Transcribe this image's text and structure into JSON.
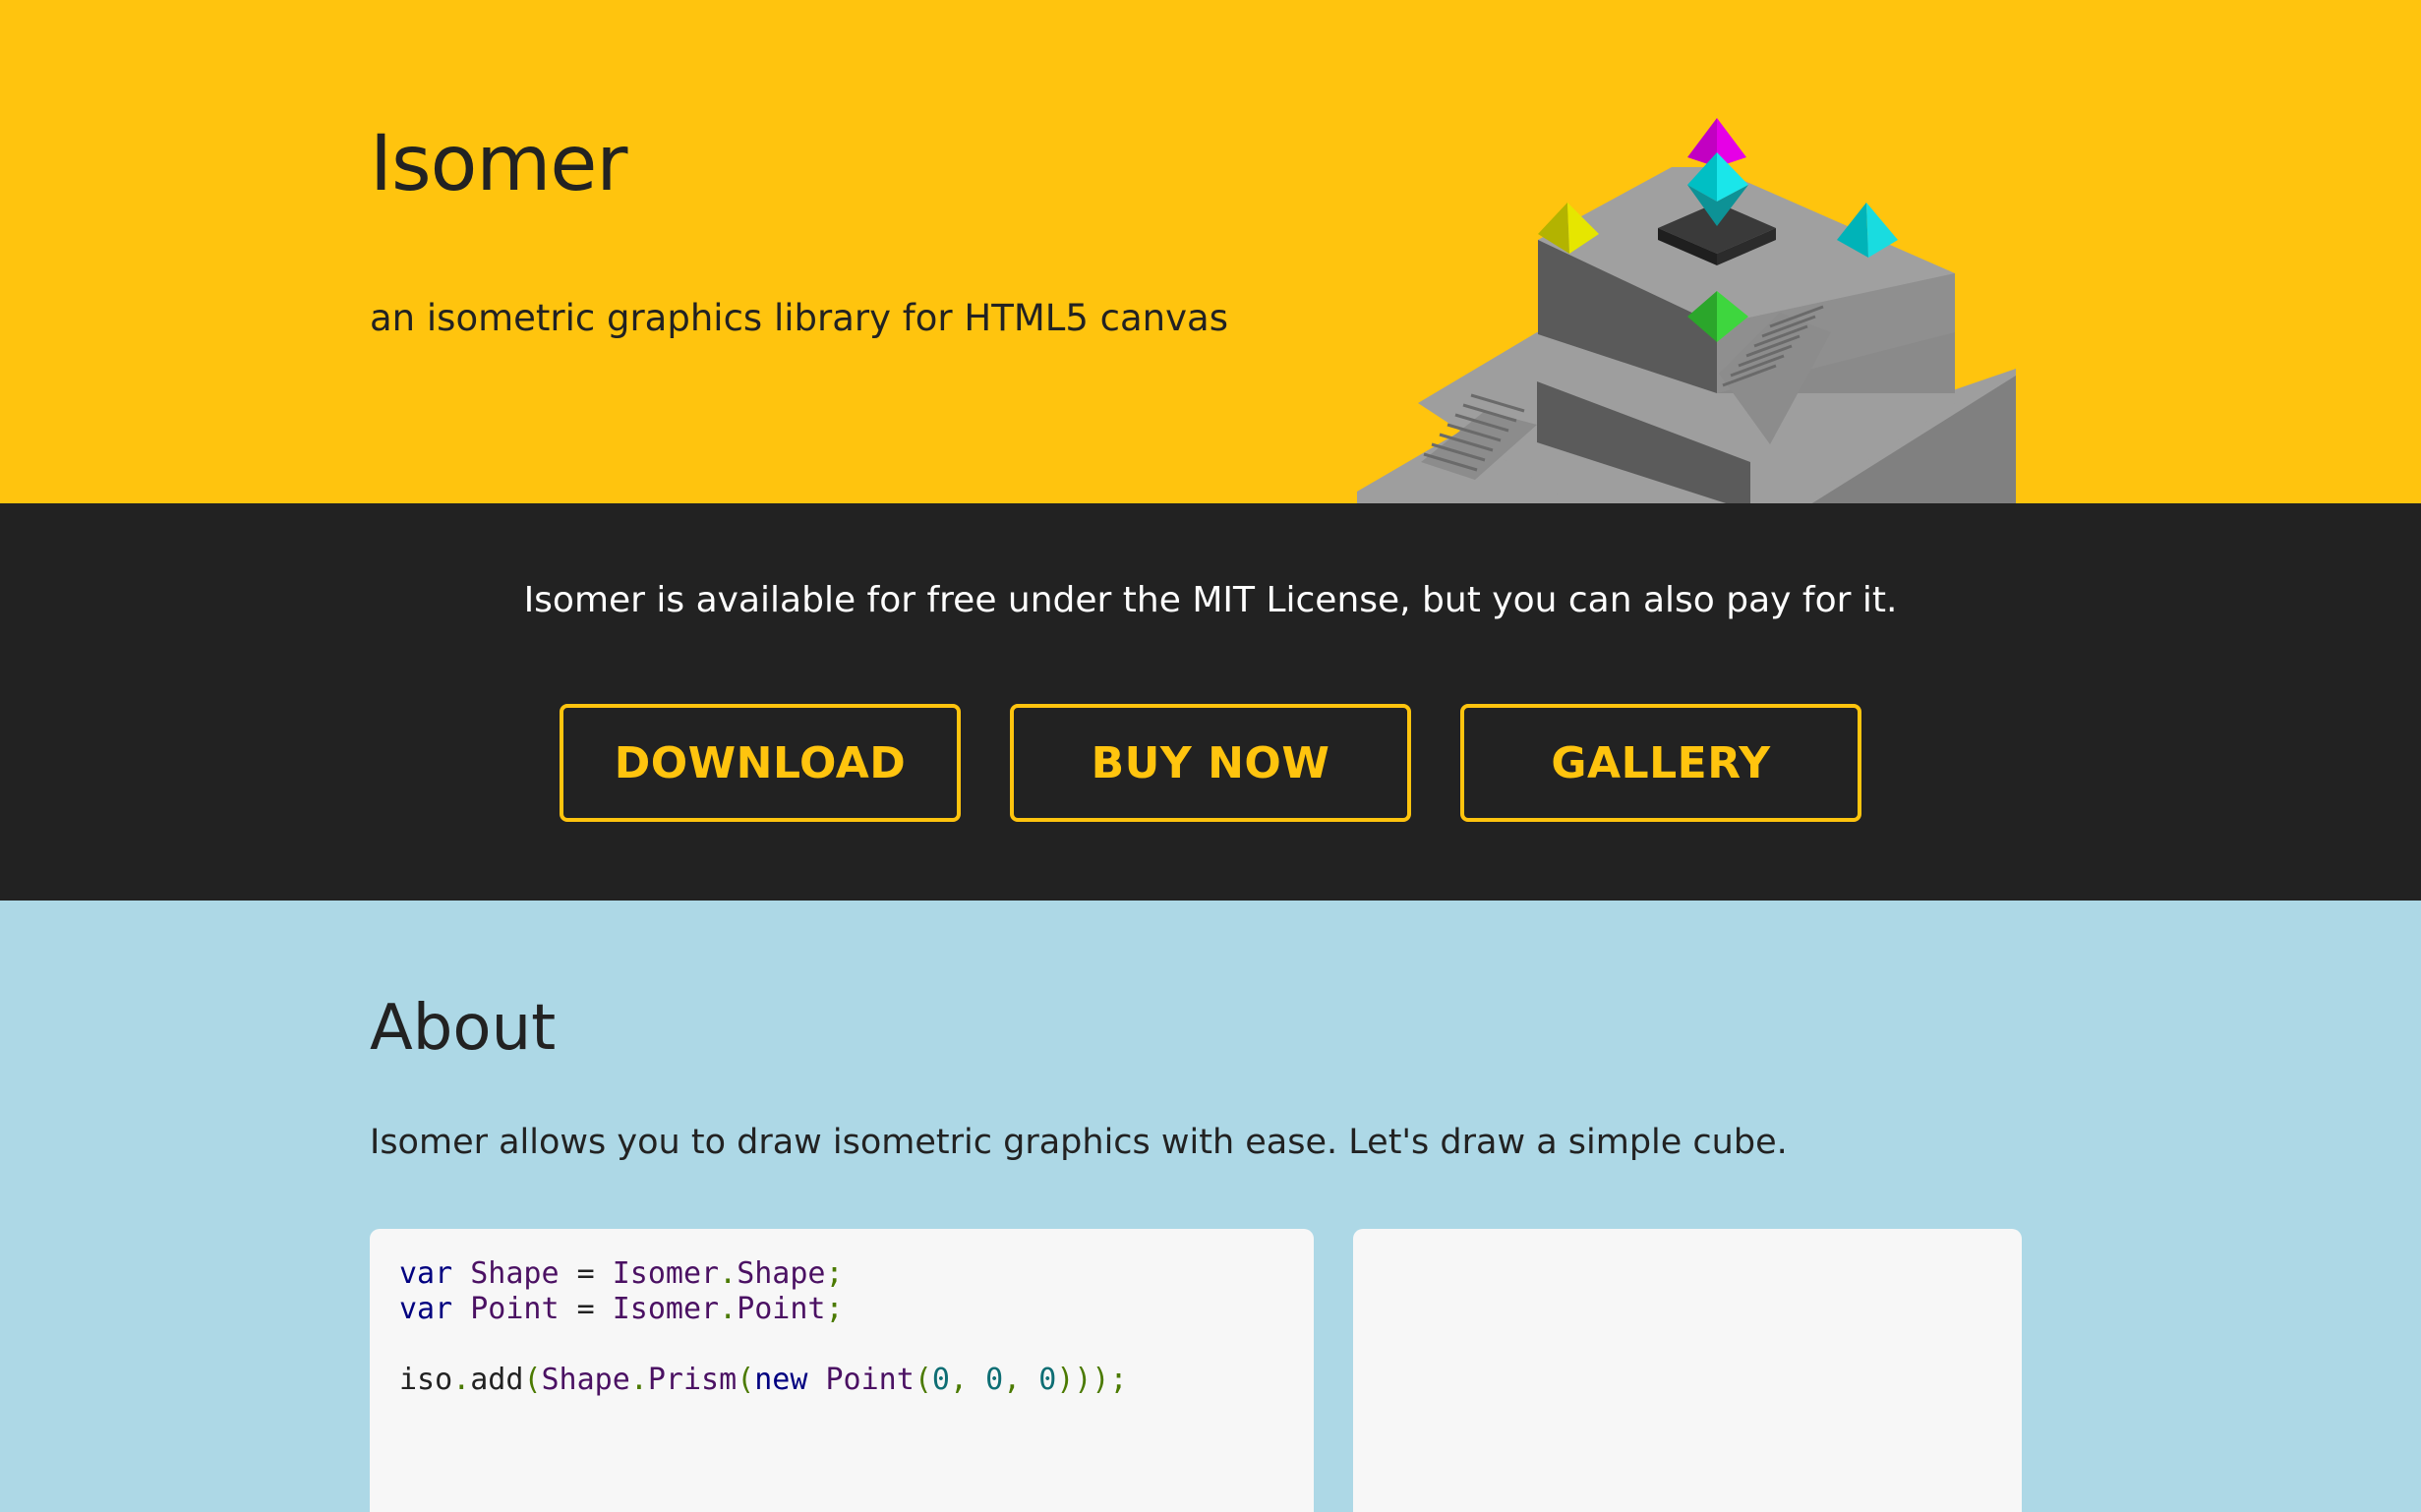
{
  "hero": {
    "title": "Isomer",
    "subtitle": "an isometric graphics library for HTML5 canvas"
  },
  "license": {
    "text": "Isomer is available for free under the MIT License, but you can also pay for it.",
    "buttons": [
      {
        "label": "DOWNLOAD"
      },
      {
        "label": "BUY NOW"
      },
      {
        "label": "GALLERY"
      }
    ]
  },
  "about": {
    "title": "About",
    "text": "Isomer allows you to draw isometric graphics with ease. Let's draw a simple cube.",
    "code": {
      "line1": {
        "kw": "var",
        "name": "Shape",
        "eq": "=",
        "obj": "Isomer",
        "dot": ".",
        "prop": "Shape",
        "semi": ";"
      },
      "line2": {
        "kw": "var",
        "name": "Point",
        "eq": "=",
        "obj": "Isomer",
        "dot": ".",
        "prop": "Point",
        "semi": ";"
      },
      "line3": {
        "call": "iso",
        "dot1": ".",
        "method": "add",
        "open1": "(",
        "cls": "Shape",
        "dot2": ".",
        "ctor": "Prism",
        "open2": "(",
        "new": "new",
        "point": "Point",
        "open3": "(",
        "x": "0",
        "c1": ", ",
        "y": "0",
        "c2": ", ",
        "z": "0",
        "close": ")));"
      }
    }
  },
  "colors": {
    "hero_bg": "#FFC40E",
    "band_bg": "#222222",
    "accent": "#FFC40E",
    "about_bg": "#ADD8E6",
    "code_bg": "#F7F7F7"
  }
}
